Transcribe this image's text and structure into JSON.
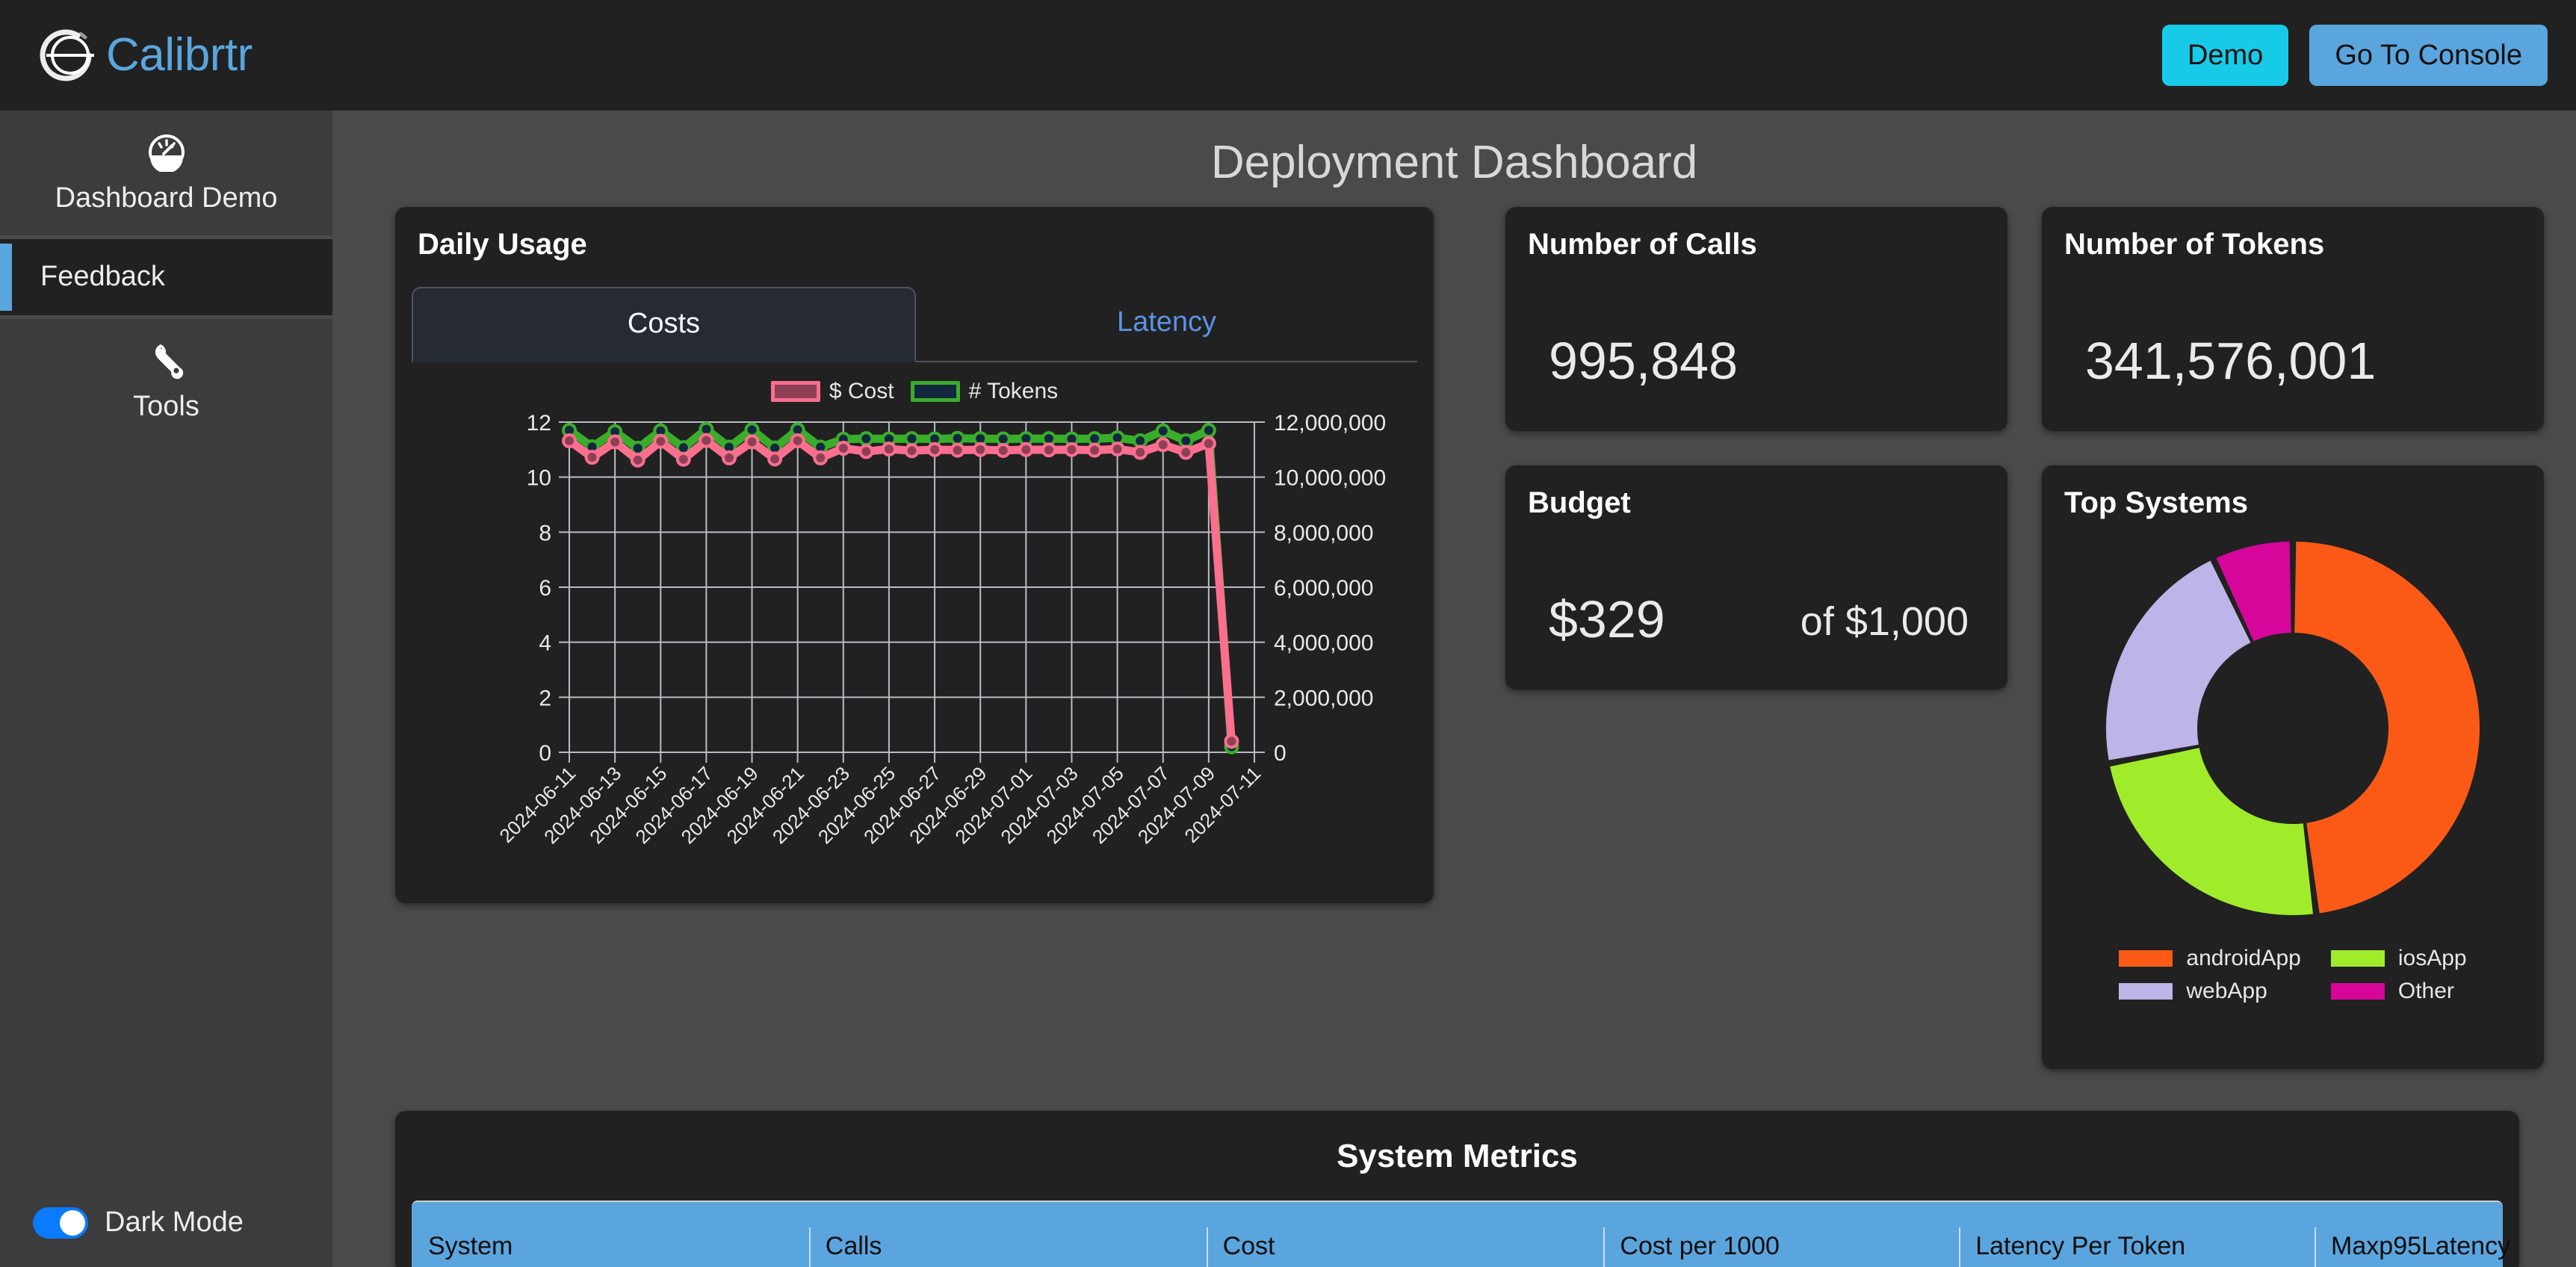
{
  "header": {
    "brand_name": "Calibrtr",
    "logo_icon": "calibrtr-ring-icon",
    "demo_label": "Demo",
    "console_label": "Go To Console"
  },
  "sidebar": {
    "items": [
      {
        "label": "Dashboard Demo",
        "icon": "speedometer-icon",
        "active": false
      },
      {
        "label": "Feedback",
        "icon": "",
        "active": true
      },
      {
        "label": "Tools",
        "icon": "wrench-icon",
        "active": false
      }
    ],
    "dark_mode": {
      "label": "Dark Mode",
      "enabled": true
    }
  },
  "main": {
    "page_title": "Deployment Dashboard",
    "usage": {
      "card_title": "Daily Usage",
      "tabs": [
        {
          "label": "Costs",
          "active": true
        },
        {
          "label": "Latency",
          "active": false
        }
      ]
    },
    "cards": {
      "calls": {
        "title": "Number of Calls",
        "value": "995,848"
      },
      "tokens": {
        "title": "Number of Tokens",
        "value": "341,576,001"
      },
      "budget": {
        "title": "Budget",
        "value": "$329",
        "suffix": "of $1,000"
      },
      "top_systems": {
        "title": "Top Systems"
      }
    },
    "metrics": {
      "title": "System Metrics",
      "columns": [
        "System",
        "Calls",
        "Cost",
        "Cost per 1000",
        "Latency Per Token",
        "Maxp95Latency"
      ]
    }
  },
  "colors": {
    "accent_blue": "#5aa5de",
    "demo_cyan": "#17cbe8",
    "toggle_blue": "#0a7aff",
    "cost_pink": "#fa6e8e",
    "tokens_green": "#3aad2a",
    "android_orange": "#fb5a16",
    "ios_green": "#a0ec2a",
    "web_lavender": "#bdb5e8",
    "other_magenta": "#d6069b",
    "card_bg": "#212121",
    "page_bg": "#4a4a4a",
    "table_header": "#5aa5de"
  },
  "chart_data": [
    {
      "type": "line",
      "title": "Daily Usage",
      "xlabel": "",
      "ylabel": "$ Cost",
      "y2label": "# Tokens",
      "ylim": [
        0,
        12
      ],
      "y2lim": [
        0,
        12000000
      ],
      "yticks": [
        0,
        2,
        4,
        6,
        8,
        10,
        12
      ],
      "y2ticks": [
        "0",
        "2,000,000",
        "4,000,000",
        "6,000,000",
        "8,000,000",
        "10,000,000",
        "12,000,000"
      ],
      "grid": true,
      "legend": [
        "$ Cost",
        "# Tokens"
      ],
      "legend_position": "top-center",
      "x": [
        "2024-06-11",
        "2024-06-12",
        "2024-06-13",
        "2024-06-14",
        "2024-06-15",
        "2024-06-16",
        "2024-06-17",
        "2024-06-18",
        "2024-06-19",
        "2024-06-20",
        "2024-06-21",
        "2024-06-22",
        "2024-06-23",
        "2024-06-24",
        "2024-06-25",
        "2024-06-26",
        "2024-06-27",
        "2024-06-28",
        "2024-06-29",
        "2024-06-30",
        "2024-07-01",
        "2024-07-02",
        "2024-07-03",
        "2024-07-04",
        "2024-07-05",
        "2024-07-06",
        "2024-07-07",
        "2024-07-08",
        "2024-07-09",
        "2024-07-10",
        "2024-07-11"
      ],
      "xtick_labels": [
        "2024-06-11",
        "2024-06-13",
        "2024-06-15",
        "2024-06-17",
        "2024-06-19",
        "2024-06-21",
        "2024-06-23",
        "2024-06-25",
        "2024-06-27",
        "2024-06-29",
        "2024-07-01",
        "2024-07-03",
        "2024-07-05",
        "2024-07-07",
        "2024-07-09",
        "2024-07-11"
      ],
      "xtick_rotation": 45,
      "series": [
        {
          "name": "$ Cost",
          "axis": "left",
          "color": "#fa6e8e",
          "values": [
            11.32,
            10.72,
            11.28,
            10.62,
            11.3,
            10.65,
            11.33,
            10.7,
            11.28,
            10.66,
            11.32,
            10.7,
            11.05,
            10.93,
            11.02,
            10.96,
            11.0,
            10.98,
            11.0,
            10.97,
            11.0,
            10.99,
            11.0,
            10.98,
            11.02,
            10.9,
            11.18,
            10.9,
            11.22,
            0.4
          ]
        },
        {
          "name": "# Tokens",
          "axis": "right",
          "color": "#3aad2a",
          "values": [
            11700000,
            11100000,
            11650000,
            11050000,
            11680000,
            11070000,
            11740000,
            11090000,
            11720000,
            11060000,
            11720000,
            11090000,
            11380000,
            11400000,
            11390000,
            11400000,
            11390000,
            11410000,
            11400000,
            11390000,
            11400000,
            11400000,
            11390000,
            11400000,
            11430000,
            11320000,
            11680000,
            11320000,
            11700000,
            200000
          ]
        }
      ]
    },
    {
      "type": "pie",
      "title": "Top Systems",
      "donut": true,
      "labels": [
        "androidApp",
        "iosApp",
        "webApp",
        "Other"
      ],
      "values": [
        48,
        24,
        21,
        7
      ],
      "colors": [
        "#fb5a16",
        "#a0ec2a",
        "#bdb5e8",
        "#d6069b"
      ],
      "legend_position": "bottom"
    }
  ]
}
